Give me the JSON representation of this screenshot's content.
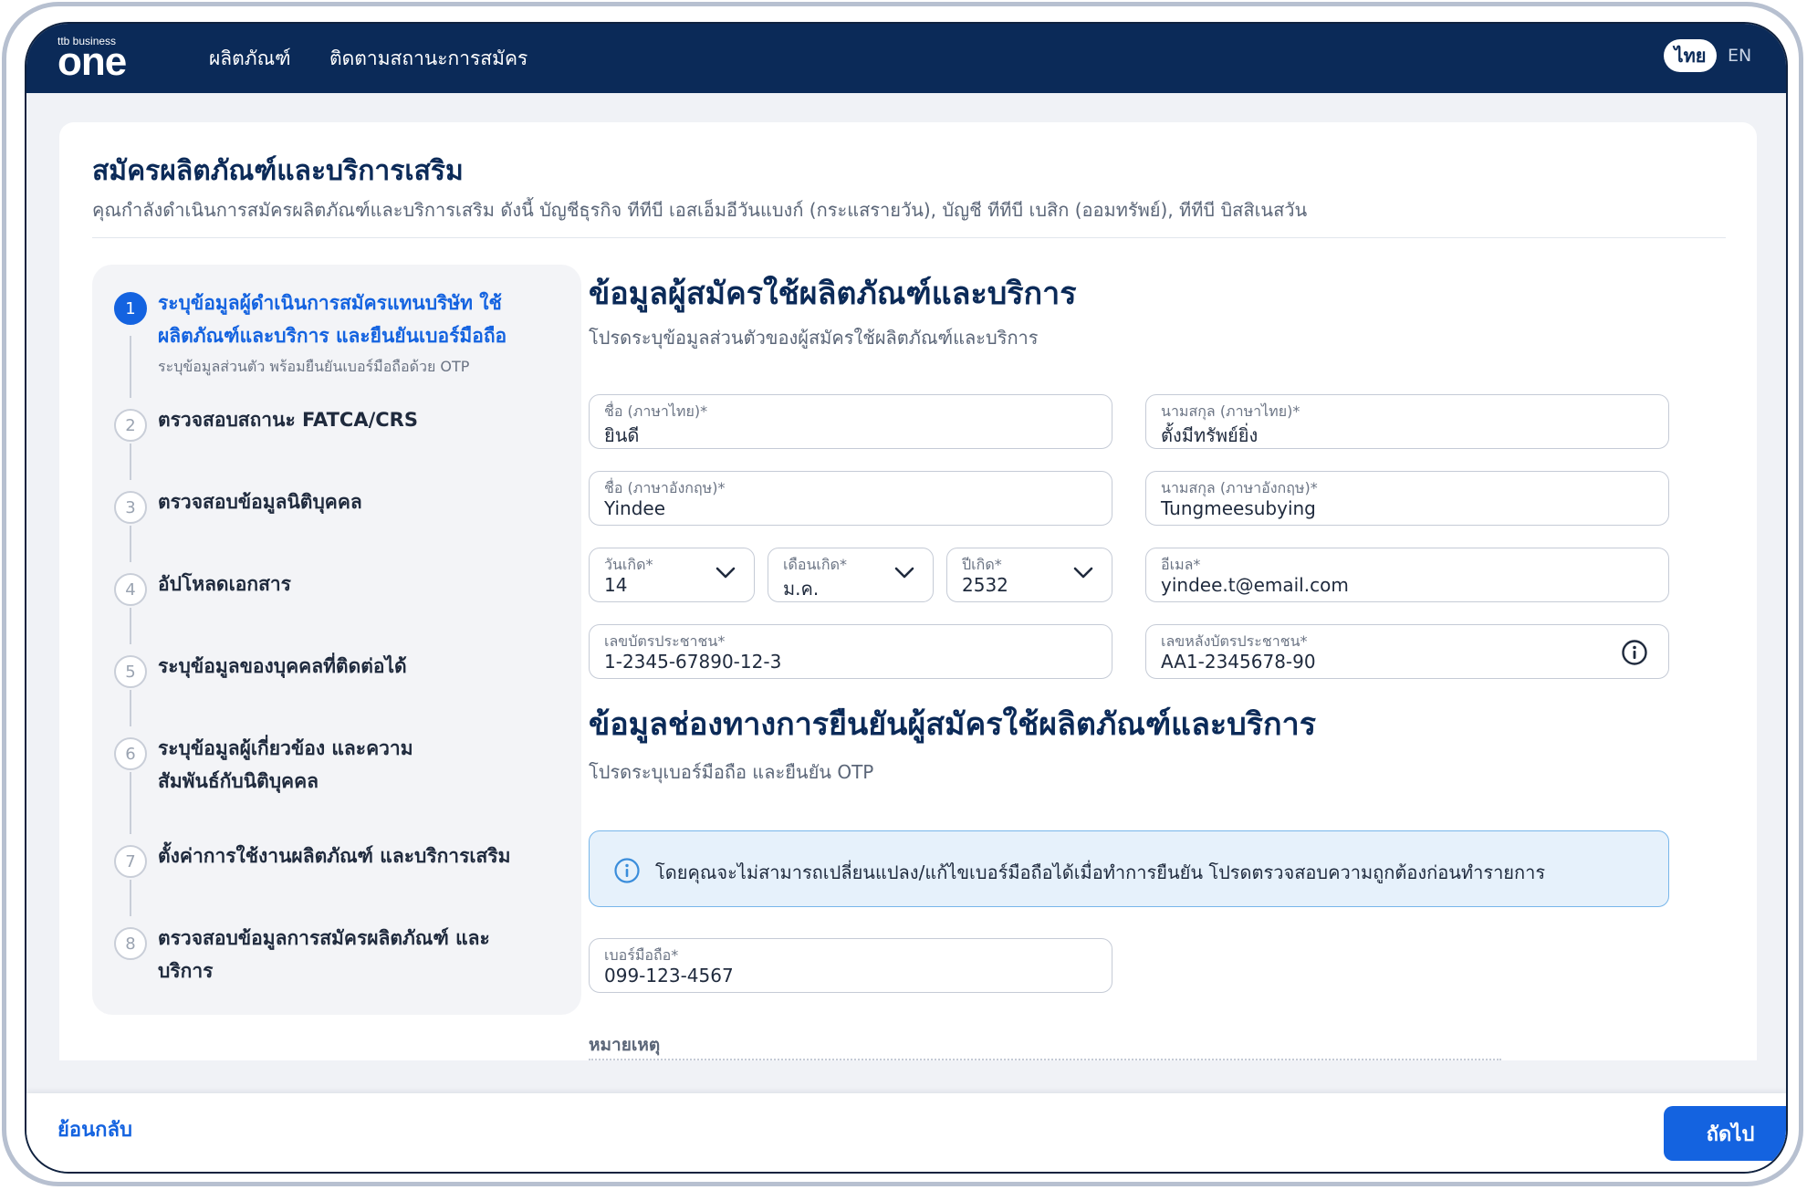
{
  "header": {
    "logo_small": "ttb business",
    "logo_main": "one",
    "nav": [
      "ผลิตภัณฑ์",
      "ติดตามสถานะการสมัคร"
    ],
    "lang_active": "ไทย",
    "lang_other": "EN"
  },
  "page": {
    "title": "สมัครผลิตภัณฑ์และบริการเสริม",
    "subtitle": "คุณกำลังดำเนินการสมัครผลิตภัณฑ์และบริการเสริม ดังนี้  บัญชีธุรกิจ ทีทีบี เอสเอ็มอีวันแบงก์ (กระแสรายวัน),  บัญชี ทีทีบี เบสิก (ออมทรัพย์),  ทีทีบี บิสสิเนสวัน"
  },
  "steps": [
    {
      "num": "1",
      "title": "ระบุข้อมูลผู้ดำเนินการสมัครแทนบริษัท ใช้ผลิตภัณฑ์และบริการ และยืนยันเบอร์มือถือ",
      "desc": "ระบุข้อมูลส่วนตัว พร้อมยืนยันเบอร์มือถือด้วย OTP",
      "active": true
    },
    {
      "num": "2",
      "title": "ตรวจสอบสถานะ FATCA/CRS"
    },
    {
      "num": "3",
      "title": "ตรวจสอบข้อมูลนิติบุคคล"
    },
    {
      "num": "4",
      "title": "อัปโหลดเอกสาร"
    },
    {
      "num": "5",
      "title": "ระบุข้อมูลของบุคคลที่ติดต่อได้"
    },
    {
      "num": "6",
      "title": "ระบุข้อมูลผู้เกี่ยวข้อง และความสัมพันธ์กับนิติบุคคล"
    },
    {
      "num": "7",
      "title": "ตั้งค่าการใช้งานผลิตภัณฑ์ และบริการเสริม"
    },
    {
      "num": "8",
      "title": "ตรวจสอบข้อมูลการสมัครผลิตภัณฑ์ และบริการ"
    }
  ],
  "applicant": {
    "title": "ข้อมูลผู้สมัครใช้ผลิตภัณฑ์และบริการ",
    "subtitle": "โปรดระบุข้อมูลส่วนตัวของผู้สมัครใช้ผลิตภัณฑ์และบริการ",
    "first_name_th": {
      "label": "ชื่อ (ภาษาไทย)*",
      "value": "ยินดี"
    },
    "last_name_th": {
      "label": "นามสกุล (ภาษาไทย)*",
      "value": "ตั้งมีทรัพย์ยิ่ง"
    },
    "first_name_en": {
      "label": "ชื่อ (ภาษาอังกฤษ)*",
      "value": "Yindee"
    },
    "last_name_en": {
      "label": "นามสกุล (ภาษาอังกฤษ)*",
      "value": "Tungmeesubying"
    },
    "birth_day": {
      "label": "วันเกิด*",
      "value": "14"
    },
    "birth_month": {
      "label": "เดือนเกิด*",
      "value": "ม.ค."
    },
    "birth_year": {
      "label": "ปีเกิด*",
      "value": "2532"
    },
    "email": {
      "label": "อีเมล*",
      "value": "yindee.t@email.com"
    },
    "id_card": {
      "label": "เลขบัตรประชาชน*",
      "value": "1-2345-67890-12-3"
    },
    "laser_code": {
      "label": "เลขหลังบัตรประชาชน*",
      "value": "AA1-2345678-90"
    }
  },
  "verification": {
    "title": "ข้อมูลช่องทางการยืนยันผู้สมัครใช้ผลิตภัณฑ์และบริการ",
    "subtitle": "โปรดระบุเบอร์มือถือ และยืนยัน OTP",
    "notice": "โดยคุณจะไม่สามารถเปลี่ยนแปลง/แก้ไขเบอร์มือถือได้เมื่อทำการยืนยัน โปรดตรวจสอบความถูกต้องก่อนทำรายการ",
    "mobile": {
      "label": "เบอร์มือถือ*",
      "value": "099-123-4567"
    },
    "remark_title": "หมายเหตุ"
  },
  "footer": {
    "back": "ย้อนกลับ",
    "next": "ถัดไป"
  },
  "colors": {
    "header_bg": "#0b2a58",
    "primary": "#1463e0",
    "notice_bg": "#e6f1fb"
  }
}
